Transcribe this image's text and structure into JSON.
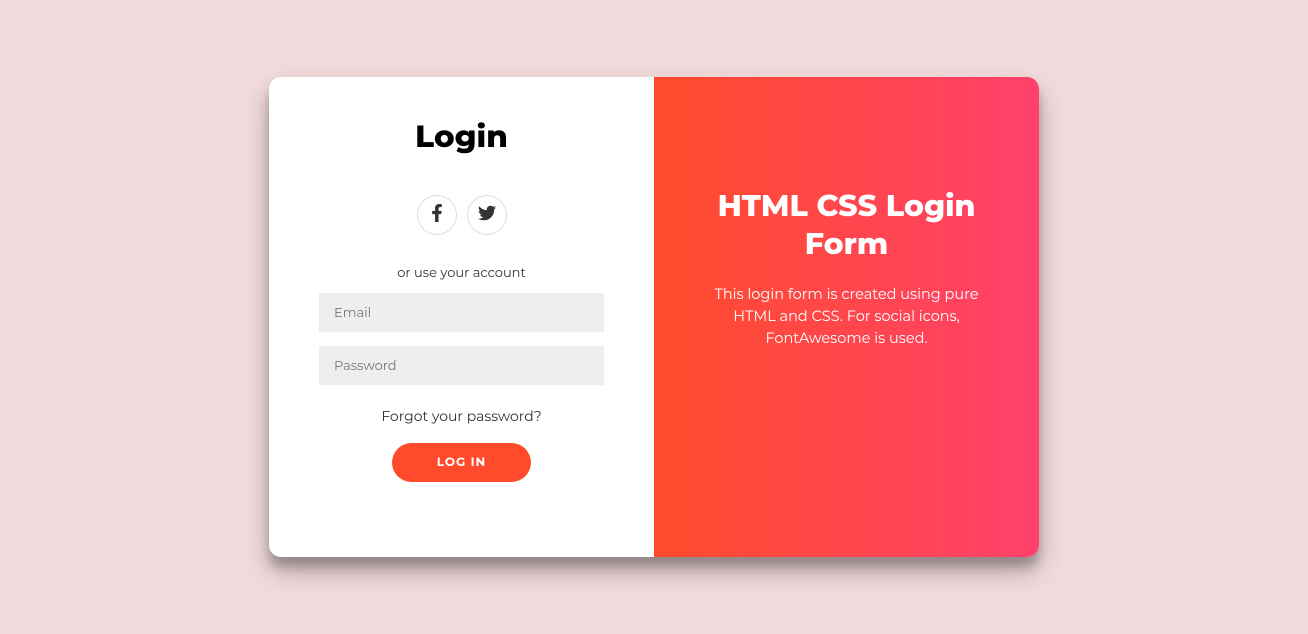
{
  "login": {
    "title": "Login",
    "subtext": "or use your account",
    "email_placeholder": "Email",
    "password_placeholder": "Password",
    "forgot_text": "Forgot your password?",
    "button_label": "LOG IN"
  },
  "overlay": {
    "title": "HTML CSS Login Form",
    "description": "This login form is created using pure HTML and CSS. For social icons, FontAwesome is used."
  }
}
